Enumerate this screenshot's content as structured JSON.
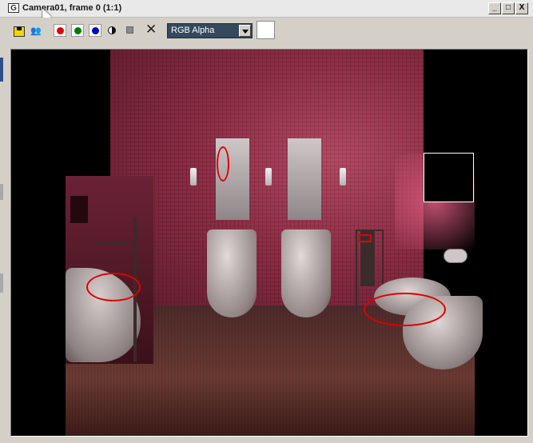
{
  "window": {
    "title": "Camera01, frame 0 (1:1)",
    "minimize_label": "_",
    "maximize_label": "□",
    "close_label": "X"
  },
  "toolbar": {
    "channels": [
      {
        "name": "red",
        "color": "#e00000"
      },
      {
        "name": "green",
        "color": "#007a00"
      },
      {
        "name": "blue",
        "color": "#0000c8"
      }
    ],
    "channel_display": {
      "selected": "RGB Alpha"
    },
    "swatch_color": "#ffffff"
  },
  "render": {
    "annotation_color": "#e00000"
  }
}
